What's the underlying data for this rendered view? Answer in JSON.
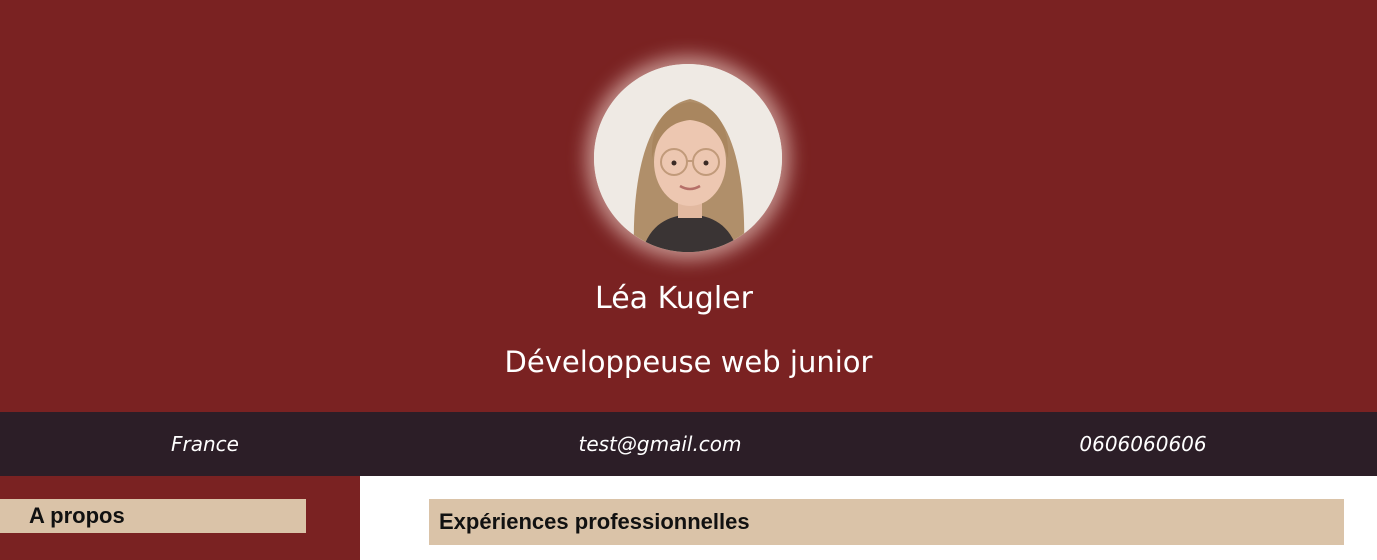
{
  "profile": {
    "name": "Léa Kugler",
    "job_title": "Développeuse web junior",
    "photo_icon": "profile-photo"
  },
  "contact": {
    "location": "France",
    "email": "test@gmail.com",
    "phone": "0606060606"
  },
  "sections": {
    "about_title": "A propos",
    "experience_title": "Expériences professionnelles"
  },
  "colors": {
    "header_bg": "#7a2222",
    "contact_bar_bg": "#2c1e27",
    "section_title_bg": "#dac3a8"
  }
}
